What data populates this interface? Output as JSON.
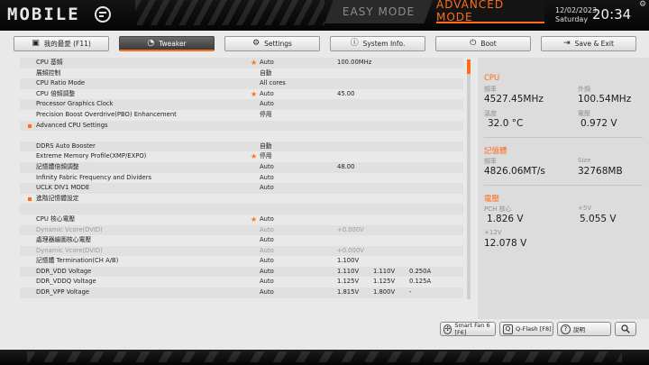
{
  "header": {
    "logo": "MOBILE",
    "mode_easy": "EASY MODE",
    "mode_advanced": "ADVANCED MODE",
    "date": "12/02/2023",
    "day": "Saturday",
    "time": "20:34",
    "gear_icon": "gear-icon"
  },
  "tabs": [
    {
      "label": "我的最愛 (F11)",
      "icon": "favorites-icon",
      "active": false
    },
    {
      "label": "Tweaker",
      "icon": "speedometer-icon",
      "active": true
    },
    {
      "label": "Settings",
      "icon": "gear-icon",
      "active": false
    },
    {
      "label": "System Info.",
      "icon": "info-icon",
      "active": false
    },
    {
      "label": "Boot",
      "icon": "power-icon",
      "active": false
    },
    {
      "label": "Save & Exit",
      "icon": "exit-icon",
      "active": false
    }
  ],
  "settings": [
    {
      "label": "CPU 基頻",
      "value": "Auto",
      "star": true,
      "v1": "100.00MHz"
    },
    {
      "label": "展頻控制",
      "value": "自動"
    },
    {
      "label": "CPU Ratio Mode",
      "value": "All cores"
    },
    {
      "label": "CPU 倍頻調整",
      "value": "Auto",
      "star": true,
      "v1": "45.00"
    },
    {
      "label": "Processor Graphics Clock",
      "value": "Auto"
    },
    {
      "label": "Precision Boost Overdrive(PBO) Enhancement",
      "value": "停用"
    },
    {
      "label": "Advanced CPU Settings",
      "bullet": true
    },
    {
      "label": ""
    },
    {
      "label": "DDRS Auto Booster",
      "value": "自動"
    },
    {
      "label": "Extreme Memory Profile(XMP/EXPO)",
      "value": "停用",
      "star": true
    },
    {
      "label": "記憶體倍頻調整",
      "value": "Auto",
      "v1": "48.00"
    },
    {
      "label": "Infinity Fabric Frequency and Dividers",
      "value": "Auto"
    },
    {
      "label": "UCLK DIV1 MODE",
      "value": "Auto"
    },
    {
      "label": "進階記憶體設定",
      "bullet": true
    },
    {
      "label": ""
    },
    {
      "label": "CPU 核心電壓",
      "value": "Auto",
      "star": true
    },
    {
      "label": "Dynamic Vcore(DVID)",
      "value": "Auto",
      "v1": "+0.000V",
      "dim": true
    },
    {
      "label": "處理器繪圖核心電壓",
      "value": "Auto"
    },
    {
      "label": "Dynamic Vcore(DVID)",
      "value": "Auto",
      "v1": "+0.000V",
      "dim": true
    },
    {
      "label": "記憶體 Termination(CH A/B)",
      "value": "Auto",
      "v1": "1.100V"
    },
    {
      "label": "DDR_VDD Voltage",
      "value": "Auto",
      "v1": "1.110V",
      "v2": "1.110V",
      "v3": "0.250A"
    },
    {
      "label": "DDR_VDDQ Voltage",
      "value": "Auto",
      "v1": "1.125V",
      "v2": "1.125V",
      "v3": "0.125A"
    },
    {
      "label": "DDR_VPP Voltage",
      "value": "Auto",
      "v1": "1.815V",
      "v2": "1.800V",
      "v3": "-"
    }
  ],
  "monitor": {
    "cpu": {
      "title": "CPU",
      "freq_label": "頻率",
      "freq": "4527.45MHz",
      "ext_label": "外頻",
      "ext": "100.54MHz",
      "temp_label": "溫度",
      "temp": "32.0 °C",
      "volt_label": "電壓",
      "volt": "0.972 V"
    },
    "memory": {
      "title": "記憶體",
      "freq_label": "頻率",
      "freq": "4826.06MT/s",
      "size_label": "Size",
      "size": "32768MB"
    },
    "voltage": {
      "title": "電壓",
      "pch_label": "PCH 核心",
      "pch": "1.826 V",
      "v5_label": "+5V",
      "v5": "5.055 V",
      "v12_label": "+12V",
      "v12": "12.078 V"
    }
  },
  "bottom": {
    "smartfan": "Smart Fan 6 [F6]",
    "qflash": "Q-Flash [F8]",
    "help": "說明",
    "search_icon": "search-icon"
  },
  "colors": {
    "accent": "#ff6d1a",
    "bar": "#0a0a0a"
  }
}
